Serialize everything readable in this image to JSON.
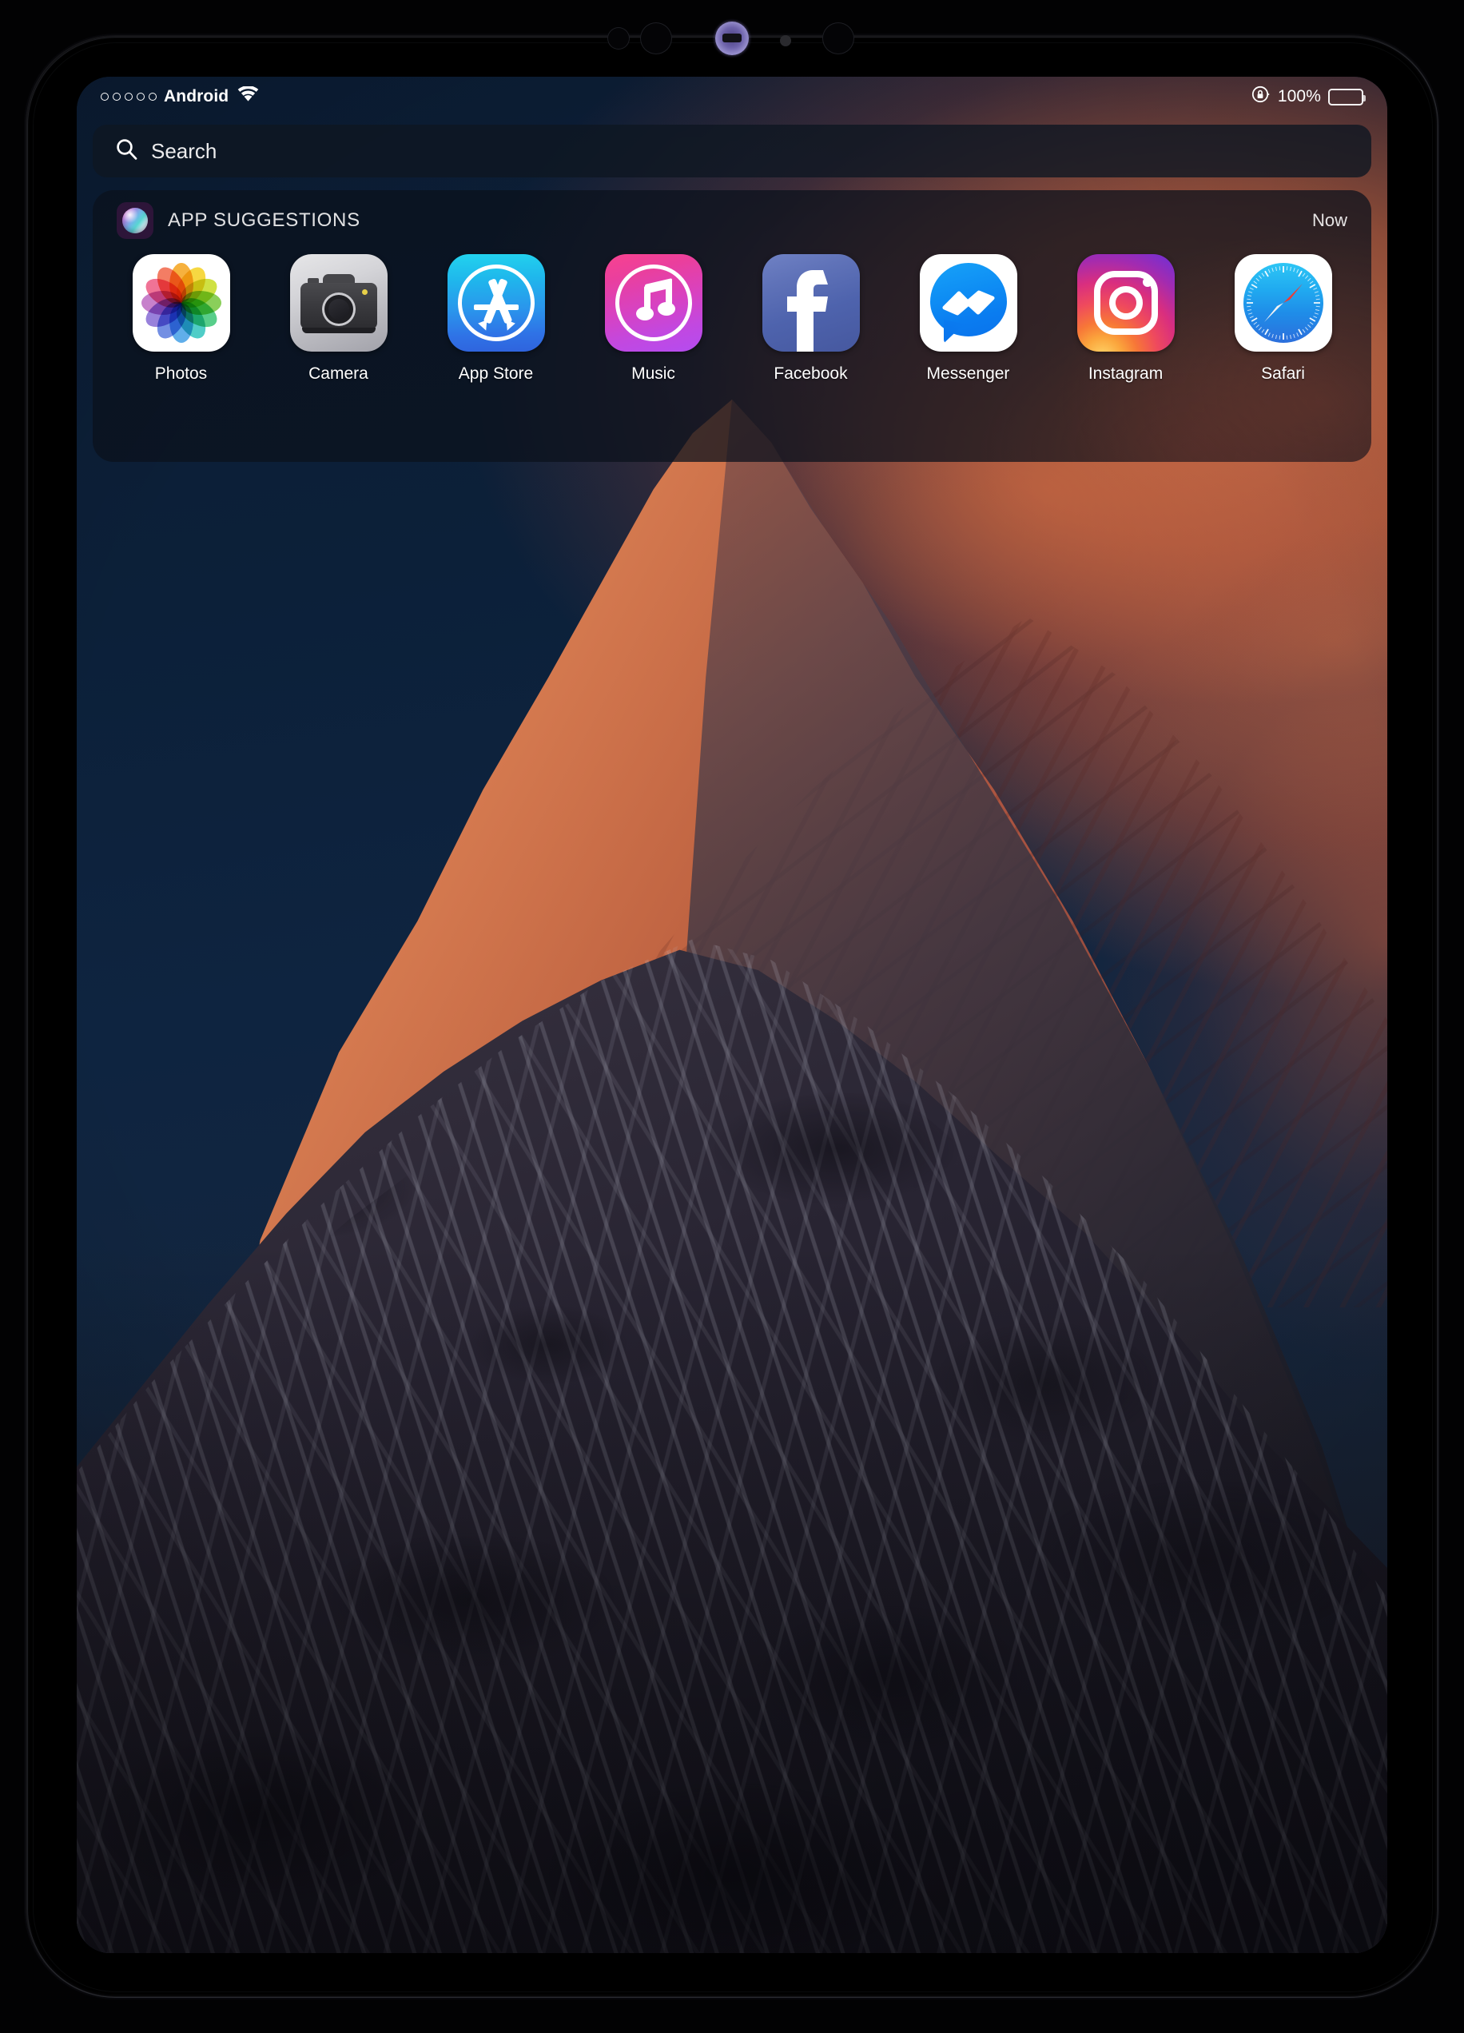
{
  "device": {
    "type": "tablet-frame",
    "sensors": [
      "proximity-sensor",
      "ambient-light-sensor",
      "front-camera",
      "microphone",
      "infrared-sensor"
    ]
  },
  "status_bar": {
    "signal_dots": 5,
    "signal_icon": "signal-dots-icon",
    "carrier": "Android",
    "wifi_icon": "wifi-icon",
    "rotation_lock_icon": "rotation-lock-icon",
    "battery_percent": "100%",
    "battery_icon": "battery-full-icon",
    "battery_level": 100
  },
  "search": {
    "icon": "search-icon",
    "placeholder": "Search",
    "value": ""
  },
  "widget": {
    "icon": "siri-icon",
    "title": "APP SUGGESTIONS",
    "timestamp": "Now",
    "apps": [
      {
        "label": "Photos",
        "icon": "photos-icon"
      },
      {
        "label": "Camera",
        "icon": "camera-icon"
      },
      {
        "label": "App Store",
        "icon": "app-store-icon"
      },
      {
        "label": "Music",
        "icon": "music-icon"
      },
      {
        "label": "Facebook",
        "icon": "facebook-icon"
      },
      {
        "label": "Messenger",
        "icon": "messenger-icon"
      },
      {
        "label": "Instagram",
        "icon": "instagram-icon"
      },
      {
        "label": "Safari",
        "icon": "safari-icon"
      }
    ]
  },
  "wallpaper": {
    "description": "Snow-capped mountain peak at sunset with orange alpenglow against deep navy sky",
    "sky_color": "#0c2039",
    "cloud_color": "#c0603e",
    "peak_lit_color": "#e09060",
    "rock_color": "#262230"
  },
  "colors": {
    "panel_background": "#0b121d",
    "search_background": "#0e1622",
    "text_primary": "#ffffff",
    "siri_icon_background": "#2d1539"
  }
}
